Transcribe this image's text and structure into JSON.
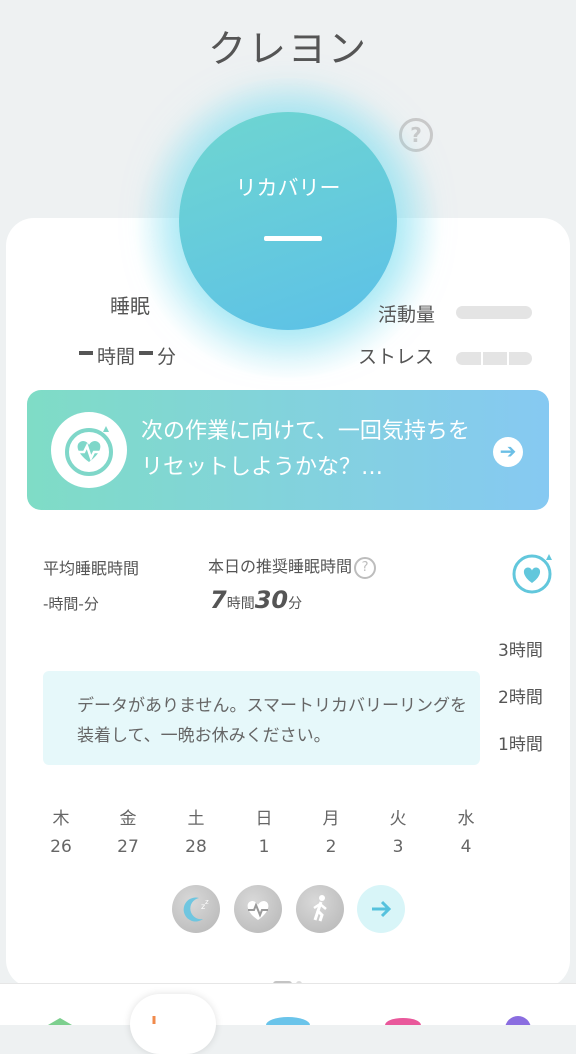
{
  "app": {
    "title": "クレヨン"
  },
  "recovery": {
    "label": "リカバリー",
    "value": "—"
  },
  "sleep": {
    "label": "睡眠",
    "hours_unit": "時間",
    "minutes_unit": "分"
  },
  "metrics": {
    "activity_label": "活動量",
    "stress_label": "ストレス"
  },
  "banner": {
    "text": "次の作業に向けて、一回気持ちをリセットしようかな？…"
  },
  "stats": {
    "avg_label": "平均睡眠時間",
    "avg_value": "-時間-分",
    "rec_label": "本日の推奨睡眠時間",
    "rec_hours": "7",
    "rec_hours_unit": "時間",
    "rec_minutes": "30",
    "rec_minutes_unit": "分"
  },
  "chart": {
    "y_ticks": [
      "3時間",
      "2時間",
      "1時間"
    ],
    "empty_message": "データがありません。スマートリカバリーリングを装着して、一晩お休みください。"
  },
  "days": [
    {
      "dow": "木",
      "date": "26"
    },
    {
      "dow": "金",
      "date": "27"
    },
    {
      "dow": "土",
      "date": "28"
    },
    {
      "dow": "日",
      "date": "1"
    },
    {
      "dow": "月",
      "date": "2"
    },
    {
      "dow": "火",
      "date": "3"
    },
    {
      "dow": "水",
      "date": "4"
    }
  ],
  "colors": {
    "accent_teal": "#6fd6d0",
    "accent_blue": "#5cc0e8",
    "banner_start": "#7fdcc6",
    "banner_end": "#86c9f2"
  }
}
